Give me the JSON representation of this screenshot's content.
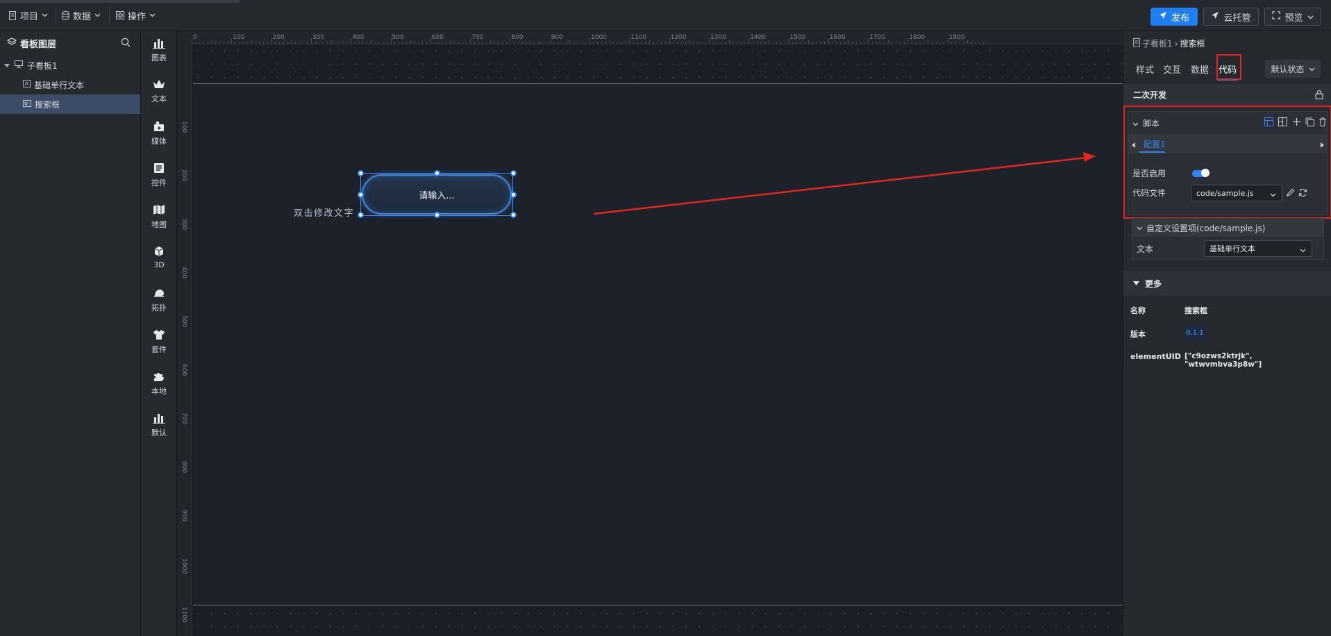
{
  "topbar": {
    "menu_project": "项目",
    "menu_data": "数据",
    "menu_operation": "操作",
    "publish": "发布",
    "cloud_hosting": "云托管",
    "preview": "预览"
  },
  "layers": {
    "title": "看板图层",
    "items": [
      {
        "label": "子看板1"
      },
      {
        "label": "基础单行文本"
      },
      {
        "label": "搜索框"
      }
    ]
  },
  "components": [
    {
      "label": "图表",
      "icon": "bar-chart-icon"
    },
    {
      "label": "文本",
      "icon": "crown-icon"
    },
    {
      "label": "媒体",
      "icon": "media-icon"
    },
    {
      "label": "控件",
      "icon": "widget-icon"
    },
    {
      "label": "地图",
      "icon": "map-icon"
    },
    {
      "label": "3D",
      "icon": "cube-icon"
    },
    {
      "label": "拓扑",
      "icon": "topology-icon"
    },
    {
      "label": "套件",
      "icon": "shirt-icon"
    },
    {
      "label": "本地",
      "icon": "puzzle-icon"
    },
    {
      "label": "默认",
      "icon": "bar-chart-icon"
    }
  ],
  "canvas": {
    "ruler_top": [
      "0",
      "100",
      "200",
      "300",
      "400",
      "500",
      "600",
      "700",
      "800",
      "900",
      "1000",
      "1100",
      "1200",
      "1300",
      "1400",
      "1500",
      "1600",
      "1700",
      "1800",
      "1900"
    ],
    "ruler_left": [
      "100",
      "200",
      "300",
      "400",
      "500",
      "600",
      "700",
      "800",
      "900",
      "1000",
      "1100"
    ],
    "text_widget": "双击修改文字",
    "search_placeholder": "请输入..."
  },
  "panel": {
    "crumb_parent": "子看板1",
    "crumb_current": "搜索框",
    "tabs": [
      "样式",
      "交互",
      "数据",
      "代码"
    ],
    "state": "默认状态",
    "section_dev": "二次开发",
    "script_title": "脚本",
    "config_tab": "配置1",
    "enabled_label": "是否启用",
    "enabled": true,
    "code_file_label": "代码文件",
    "code_file_value": "code/sample.js",
    "custom_title": "自定义设置项(code/sample.js)",
    "custom_text_label": "文本",
    "custom_text_value": "基础单行文本",
    "more_title": "更多",
    "name_label": "名称",
    "name_value": "搜索框",
    "version_label": "版本",
    "version_value": "0.1.1",
    "uid_label": "elementUID",
    "uid_value": "[\"c9ozws2ktrjk\", \"wtwvmbva3p8w\"]"
  },
  "colors": {
    "accent": "#2f84f5",
    "highlight": "#e3261e",
    "panel_bg": "#26292e",
    "canvas_bg": "#1c212a"
  }
}
